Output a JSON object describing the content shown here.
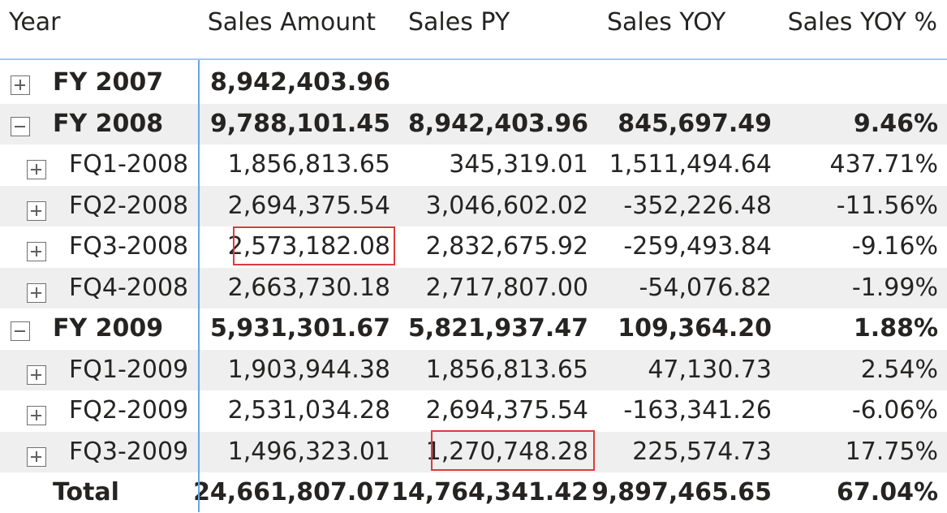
{
  "columns": {
    "year": "Year",
    "sales_amount": "Sales Amount",
    "sales_py": "Sales PY",
    "sales_yoy": "Sales YOY",
    "sales_yoy_pct": "Sales YOY %"
  },
  "rows": [
    {
      "label": "FY 2007",
      "level": "year",
      "toggle": "expand",
      "sales_amount": "8,942,403.96",
      "sales_py": "",
      "sales_yoy": "",
      "sales_yoy_pct": ""
    },
    {
      "label": "FY 2008",
      "level": "year",
      "toggle": "collapse",
      "sales_amount": "9,788,101.45",
      "sales_py": "8,942,403.96",
      "sales_yoy": "845,697.49",
      "sales_yoy_pct": "9.46%"
    },
    {
      "label": "FQ1-2008",
      "level": "quarter",
      "toggle": "expand",
      "sales_amount": "1,856,813.65",
      "sales_py": "345,319.01",
      "sales_yoy": "1,511,494.64",
      "sales_yoy_pct": "437.71%"
    },
    {
      "label": "FQ2-2008",
      "level": "quarter",
      "toggle": "expand",
      "sales_amount": "2,694,375.54",
      "sales_py": "3,046,602.02",
      "sales_yoy": "-352,226.48",
      "sales_yoy_pct": "-11.56%"
    },
    {
      "label": "FQ3-2008",
      "level": "quarter",
      "toggle": "expand",
      "sales_amount": "2,573,182.08",
      "sales_py": "2,832,675.92",
      "sales_yoy": "-259,493.84",
      "sales_yoy_pct": "-9.16%"
    },
    {
      "label": "FQ4-2008",
      "level": "quarter",
      "toggle": "expand",
      "sales_amount": "2,663,730.18",
      "sales_py": "2,717,807.00",
      "sales_yoy": "-54,076.82",
      "sales_yoy_pct": "-1.99%"
    },
    {
      "label": "FY 2009",
      "level": "year",
      "toggle": "collapse",
      "sales_amount": "5,931,301.67",
      "sales_py": "5,821,937.47",
      "sales_yoy": "109,364.20",
      "sales_yoy_pct": "1.88%"
    },
    {
      "label": "FQ1-2009",
      "level": "quarter",
      "toggle": "expand",
      "sales_amount": "1,903,944.38",
      "sales_py": "1,856,813.65",
      "sales_yoy": "47,130.73",
      "sales_yoy_pct": "2.54%"
    },
    {
      "label": "FQ2-2009",
      "level": "quarter",
      "toggle": "expand",
      "sales_amount": "2,531,034.28",
      "sales_py": "2,694,375.54",
      "sales_yoy": "-163,341.26",
      "sales_yoy_pct": "-6.06%"
    },
    {
      "label": "FQ3-2009",
      "level": "quarter",
      "toggle": "expand",
      "sales_amount": "1,496,323.01",
      "sales_py": "1,270,748.28",
      "sales_yoy": "225,574.73",
      "sales_yoy_pct": "17.75%"
    }
  ],
  "total": {
    "label": "Total",
    "sales_amount": "24,661,807.07",
    "sales_py": "14,764,341.42",
    "sales_yoy": "9,897,465.65",
    "sales_yoy_pct": "67.04%"
  },
  "colors": {
    "header_underline": "#a9c8ec",
    "row_divider": "#6aa3e6",
    "shaded_row": "#efefef",
    "highlight_box": "#e0393e",
    "text": "#252423"
  }
}
